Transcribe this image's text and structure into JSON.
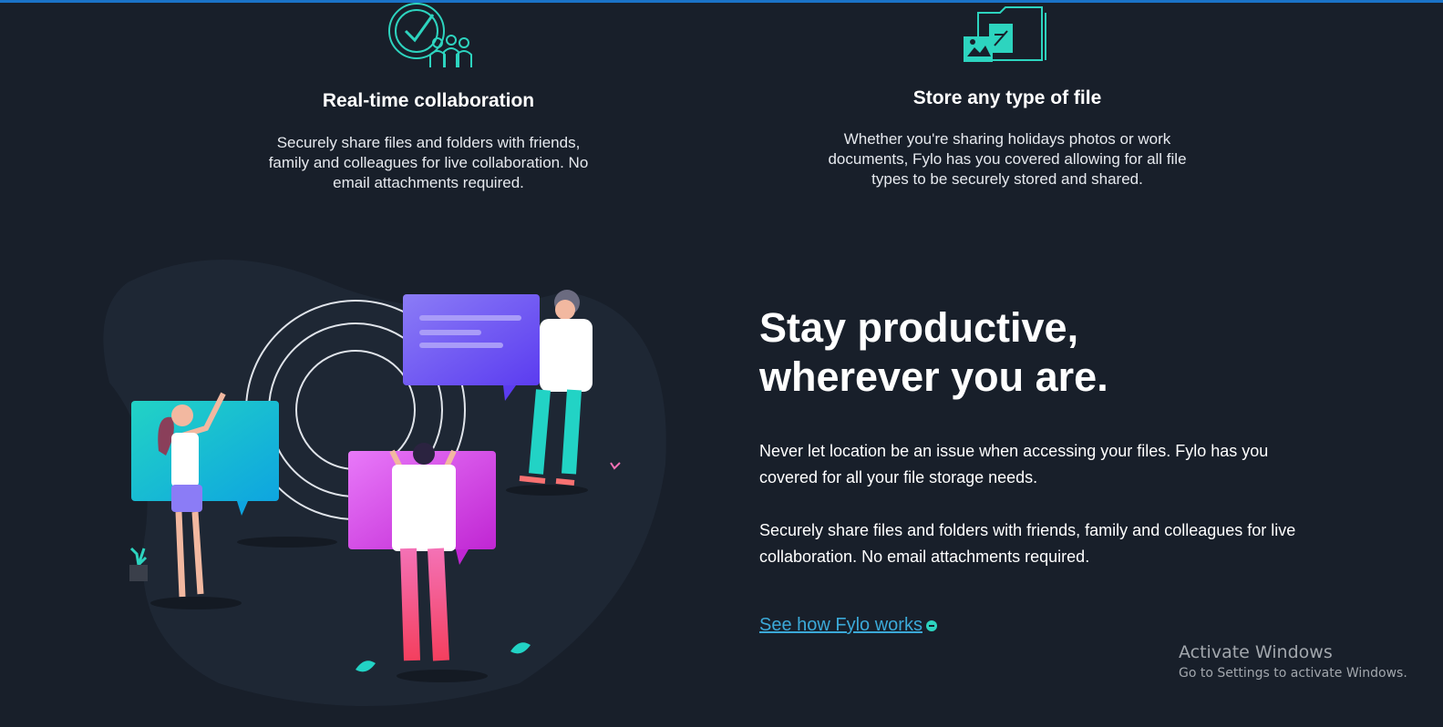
{
  "features": [
    {
      "icon": "collaboration-icon",
      "title": "Real-time collaboration",
      "text": "Securely share files and folders with friends, family and colleagues for live collaboration. No email attachments required."
    },
    {
      "icon": "file-storage-icon",
      "title": "Store any type of file",
      "text": "Whether you're sharing holidays photos or work documents, Fylo has you covered allowing for all file types to be securely stored and shared."
    }
  ],
  "productive": {
    "heading": "Stay productive, wherever you are.",
    "paragraph_1": "Never let location be an issue when accessing your files. Fylo has you covered for all your file storage needs.",
    "paragraph_2": "Securely share files and folders with friends, family and colleagues for live collaboration. No email attachments required.",
    "cta_label": "See how Fylo works "
  },
  "watermark": {
    "title": "Activate Windows",
    "subtitle": "Go to Settings to activate Windows."
  },
  "colors": {
    "background": "#181f2a",
    "accent_cyan": "#2dd4bf",
    "link": "#3ba9d8"
  }
}
